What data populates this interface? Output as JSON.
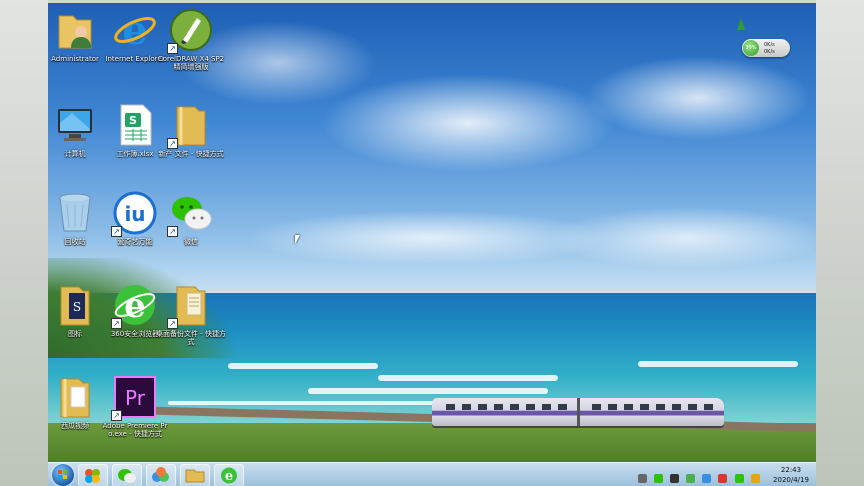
{
  "desktop": {
    "icons": [
      {
        "name": "icon-administrator",
        "label": "Administrator",
        "glyph": "user-folder-icon"
      },
      {
        "name": "icon-internet-explorer",
        "label": "Internet Explorer",
        "glyph": "ie-icon"
      },
      {
        "name": "icon-coreldraw",
        "label": "CorelDRAW X4 SP2 精简增强版",
        "glyph": "coreldraw-icon"
      },
      {
        "name": "icon-computer",
        "label": "计算机",
        "glyph": "computer-icon"
      },
      {
        "name": "icon-xlsx",
        "label": "工作簿.xlsx",
        "glyph": "spreadsheet-icon"
      },
      {
        "name": "icon-new-folder",
        "label": "新产 文件 - 快捷方式",
        "glyph": "folder-icon"
      },
      {
        "name": "icon-recycle-bin",
        "label": "回收站",
        "glyph": "recycle-bin-icon"
      },
      {
        "name": "icon-iu",
        "label": "爱奇艺万能",
        "glyph": "iu-icon"
      },
      {
        "name": "icon-wechat",
        "label": "微信",
        "glyph": "wechat-icon"
      },
      {
        "name": "icon-tubiao",
        "label": "图标",
        "glyph": "book-folder-icon"
      },
      {
        "name": "icon-360-browser",
        "label": "360安全浏览器",
        "glyph": "360-browser-icon"
      },
      {
        "name": "icon-desktop-backup",
        "label": "桌面备份文件 - 快捷方式",
        "glyph": "folder-icon"
      },
      {
        "name": "icon-xigua",
        "label": "西瓜视频",
        "glyph": "folder-icon"
      },
      {
        "name": "icon-premiere",
        "label": "Adobe Premiere Pro.exe - 快捷方式",
        "glyph": "premiere-icon"
      }
    ]
  },
  "netwidget": {
    "percent": "39%",
    "up": "0K/s",
    "down": "0K/s"
  },
  "taskbar": {
    "time": "22:43",
    "date": "2020/4/19"
  },
  "colors": {
    "accent": "#1b5fa8",
    "wechat": "#2dc100",
    "premiere": "#2a0a3a",
    "premiere_text": "#e77cff"
  }
}
